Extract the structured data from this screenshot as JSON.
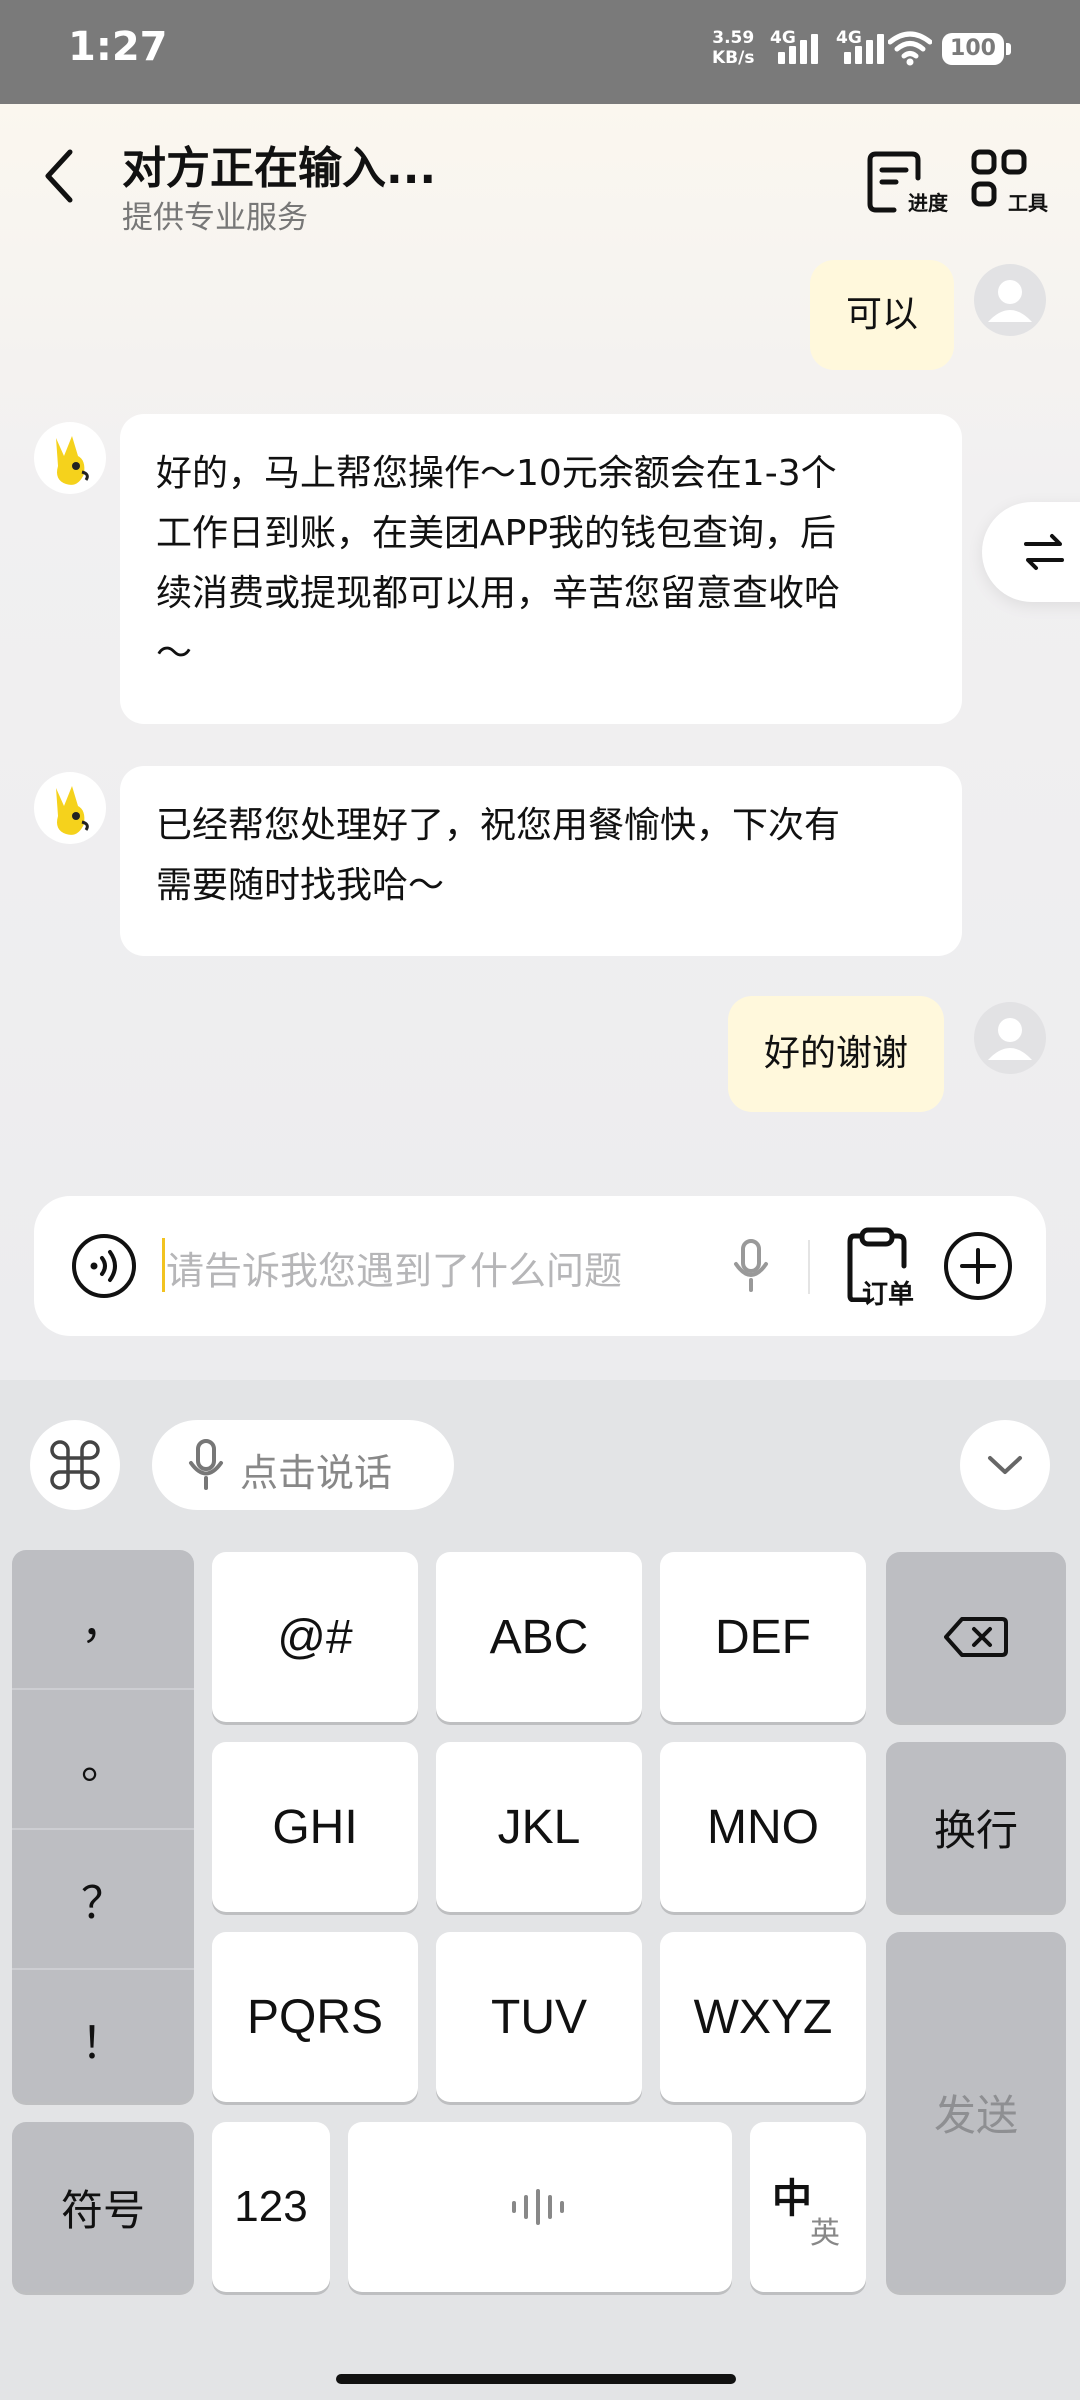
{
  "status_bar": {
    "time": "1:27",
    "net_speed_value": "3.59",
    "net_speed_unit": "KB/s",
    "signal1_label": "4G",
    "signal2_label": "4G",
    "battery": "100"
  },
  "header": {
    "title": "对方正在输入...",
    "subtitle": "提供专业服务",
    "progress_label": "进度",
    "tools_label": "工具"
  },
  "messages": [
    {
      "from": "user",
      "text": "可以"
    },
    {
      "from": "bot",
      "lines": [
        "好的，马上帮您操作～10元余额会在1-3个",
        "工作日到账，在美团APP我的钱包查询，后",
        "续消费或提现都可以用，辛苦您留意查收哈",
        "～"
      ]
    },
    {
      "from": "bot",
      "lines": [
        "已经帮您处理好了，祝您用餐愉快，下次有",
        "需要随时找我哈～"
      ]
    },
    {
      "from": "user",
      "text": "好的谢谢"
    }
  ],
  "input": {
    "placeholder": "请告诉我您遇到了什么问题",
    "order_label": "订单"
  },
  "keyboard": {
    "voice_label": "点击说话",
    "punctuation": [
      "，",
      "。",
      "？",
      "！"
    ],
    "symbols_label": "符号",
    "rows": [
      [
        "@#",
        "ABC",
        "DEF"
      ],
      [
        "GHI",
        "JKL",
        "MNO"
      ],
      [
        "PQRS",
        "TUV",
        "WXYZ"
      ]
    ],
    "newline_label": "换行",
    "send_label": "发送",
    "num_label": "123",
    "lang_primary": "中",
    "lang_secondary": "英"
  },
  "colors": {
    "user_bubble": "#fff8dc",
    "bot_bubble": "#ffffff",
    "caret": "#f2c320",
    "mascot": "#f5d21c"
  }
}
